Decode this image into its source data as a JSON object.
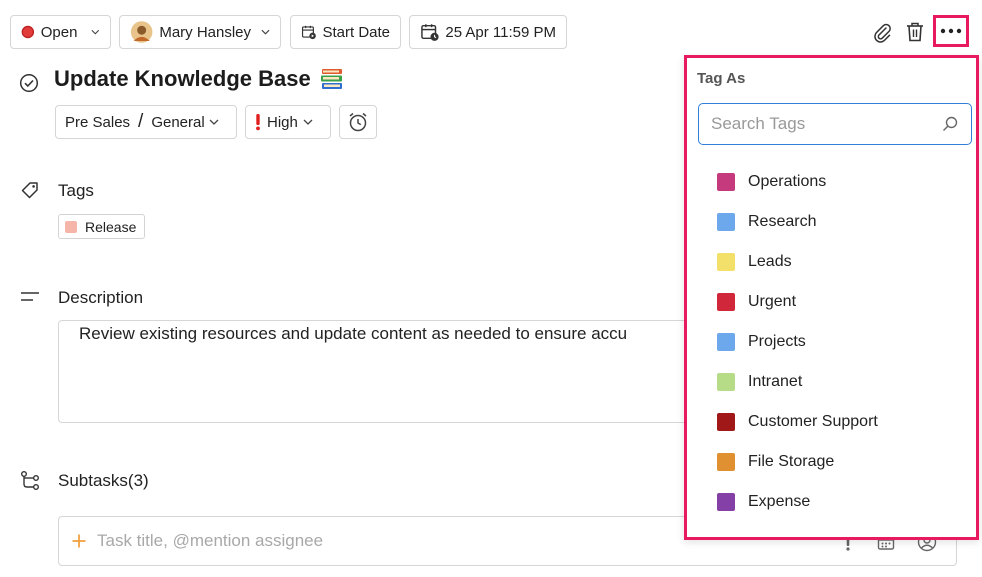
{
  "toolbar": {
    "status_label": "Open",
    "assignee_name": "Mary Hansley",
    "start_date_label": "Start Date",
    "due_date_label": "25 Apr 11:59 PM"
  },
  "task": {
    "title": "Update Knowledge Base",
    "project": "Pre Sales",
    "separator": "/",
    "list": "General",
    "priority": "High"
  },
  "tags_section": {
    "label": "Tags",
    "tags": [
      {
        "label": "Release",
        "color": "#f5b5a8"
      }
    ]
  },
  "description_section": {
    "label": "Description",
    "text": "Review existing resources and update content as needed to ensure accu"
  },
  "subtasks_section": {
    "label": "Subtasks(3)",
    "placeholder": "Task title, @mention assignee"
  },
  "tag_menu": {
    "title": "Tag As",
    "search_placeholder": "Search Tags",
    "items": [
      {
        "label": "Operations",
        "color": "#c43a7c"
      },
      {
        "label": "Research",
        "color": "#6ea8ec"
      },
      {
        "label": "Leads",
        "color": "#f2e06a"
      },
      {
        "label": "Urgent",
        "color": "#d0283a"
      },
      {
        "label": "Projects",
        "color": "#6ea8ec"
      },
      {
        "label": "Intranet",
        "color": "#b6dc88"
      },
      {
        "label": "Customer Support",
        "color": "#a01818"
      },
      {
        "label": "File Storage",
        "color": "#e09030"
      },
      {
        "label": "Expense",
        "color": "#8540a8"
      }
    ]
  },
  "colors": {
    "highlight": "#e8195e",
    "search_border": "#2f7fd9",
    "status_dot": "#e23b3b",
    "priority_icon": "#e02020",
    "add_icon": "#f0a040"
  }
}
